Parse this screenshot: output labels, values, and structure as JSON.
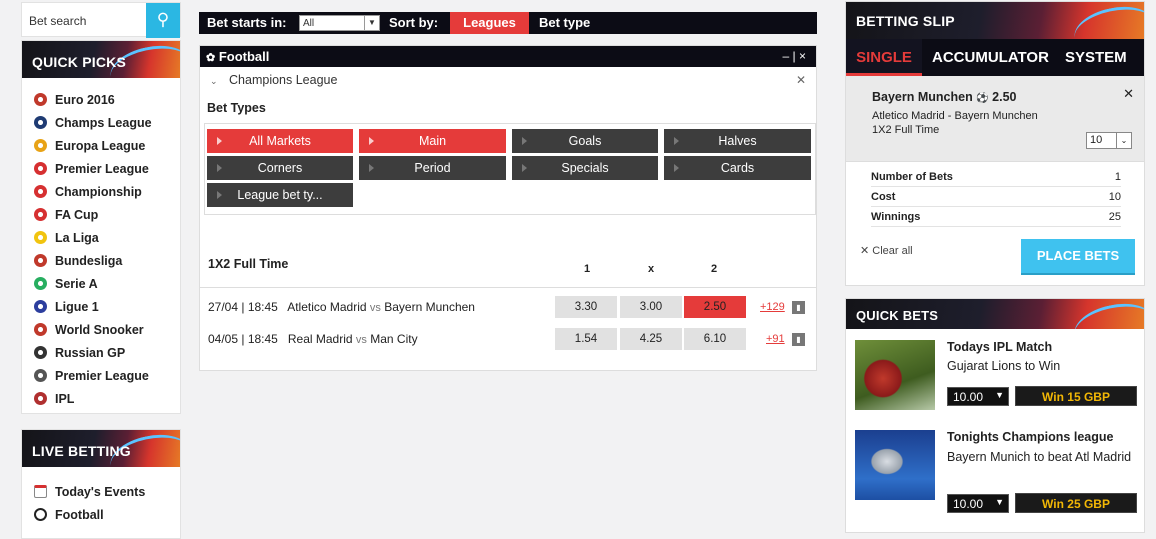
{
  "search": {
    "placeholder": "Bet search"
  },
  "quick_picks": {
    "title": "QUICK PICKS",
    "items": [
      {
        "label": "Euro 2016",
        "icon": "euro-2016-icon",
        "color": "#c0392b"
      },
      {
        "label": "Champs League",
        "icon": "champions-league-icon",
        "color": "#1f3b73"
      },
      {
        "label": "Europa League",
        "icon": "europa-league-icon",
        "color": "#e8a317"
      },
      {
        "label": "Premier League",
        "icon": "england-flag-icon",
        "color": "#d63031"
      },
      {
        "label": "Championship",
        "icon": "england-flag-icon",
        "color": "#d63031"
      },
      {
        "label": "FA Cup",
        "icon": "england-flag-icon",
        "color": "#d63031"
      },
      {
        "label": "La Liga",
        "icon": "spain-flag-icon",
        "color": "#f1c40f"
      },
      {
        "label": "Bundesliga",
        "icon": "germany-flag-icon",
        "color": "#c0392b"
      },
      {
        "label": "Serie A",
        "icon": "italy-flag-icon",
        "color": "#27ae60"
      },
      {
        "label": "Ligue 1",
        "icon": "france-flag-icon",
        "color": "#2c3e9e"
      },
      {
        "label": "World Snooker",
        "icon": "snooker-ball-icon",
        "color": "#c0392b"
      },
      {
        "label": "Russian GP",
        "icon": "checkered-flag-icon",
        "color": "#333333"
      },
      {
        "label": "Premier League",
        "icon": "darts-icon",
        "color": "#555555"
      },
      {
        "label": "IPL",
        "icon": "cricket-ball-icon",
        "color": "#b03030"
      }
    ]
  },
  "live_betting": {
    "title": "LIVE BETTING",
    "items": [
      {
        "label": "Today's Events",
        "icon": "calendar-icon"
      },
      {
        "label": "Football",
        "icon": "football-icon"
      }
    ]
  },
  "topbar": {
    "bet_starts_label": "Bet starts in:",
    "bet_starts_value": "All",
    "sort_by_label": "Sort by:",
    "leagues": "Leagues",
    "bet_type": "Bet type"
  },
  "football": {
    "title": "Football",
    "controls": "– | ×",
    "league": "Champions League",
    "bet_types_label": "Bet Types",
    "markets": [
      "All Markets",
      "Main",
      "Goals",
      "Halves",
      "Corners",
      "Period",
      "Specials",
      "Cards",
      "League bet ty..."
    ],
    "market_title": "1X2 Full Time",
    "col_1": "1",
    "col_x": "x",
    "col_2": "2",
    "matches": [
      {
        "time": "27/04 | 18:45",
        "home": "Atletico Madrid",
        "vs": "vs",
        "away": "Bayern Munchen",
        "odds": [
          "3.30",
          "3.00",
          "2.50"
        ],
        "more": "+129"
      },
      {
        "time": "04/05 | 18:45",
        "home": "Real Madrid",
        "vs": "vs",
        "away": "Man City",
        "odds": [
          "1.54",
          "4.25",
          "6.10"
        ],
        "more": "+91"
      }
    ]
  },
  "slip": {
    "title": "BETTING SLIP",
    "tabs": [
      "SINGLE",
      "ACCUMULATOR",
      "SYSTEM"
    ],
    "selection": "Bayern Munchen",
    "selection_odds": "2.50",
    "match": "Atletico Madrid - Bayern Munchen",
    "market": "1X2 Full Time",
    "stake": "10",
    "rows": [
      {
        "label": "Number of Bets",
        "value": "1"
      },
      {
        "label": "Cost",
        "value": "10"
      },
      {
        "label": "Winnings",
        "value": "25"
      }
    ],
    "clear": "Clear all",
    "place": "PLACE BETS"
  },
  "quick_bets": {
    "title": "QUICK BETS",
    "items": [
      {
        "title": "Todays IPL Match",
        "desc": "Gujarat Lions to Win",
        "stake": "10.00",
        "win": "Win  15 GBP"
      },
      {
        "title": "Tonights Champions league",
        "desc": "Bayern Munich to beat Atl Madrid",
        "stake": "10.00",
        "win": "Win  25 GBP"
      }
    ]
  }
}
